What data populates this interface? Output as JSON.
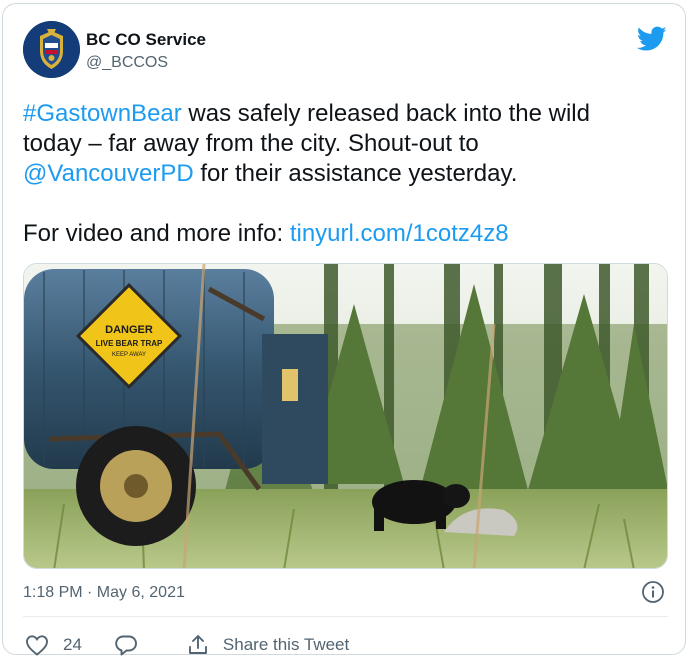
{
  "account": {
    "name": "BC CO Service",
    "handle": "@_BCCOS"
  },
  "tweet": {
    "hashtag": "#GastownBear",
    "line1_rest": " was safely released back into the wild",
    "line2": "today – far away from the city. Shout-out to",
    "mention": "@VancouverPD",
    "line3_rest": " for their assistance yesterday.",
    "video_prefix": "For video and more info: ",
    "video_link": "tinyurl.com/1cotz4z8"
  },
  "media": {
    "sign_line1": "DANGER",
    "sign_line2": "LIVE BEAR TRAP",
    "sign_line3": "KEEP AWAY"
  },
  "meta": {
    "timestamp": "1:18 PM · May 6, 2021"
  },
  "actions": {
    "like_count": "24",
    "share_label": "Share this Tweet"
  },
  "icons": {
    "twitter_logo": "twitter-bird-icon",
    "info": "info-icon",
    "like": "heart-icon",
    "reply": "reply-icon",
    "share": "share-icon"
  },
  "colors": {
    "link": "#1d9bf0",
    "text": "#0f1419",
    "secondary": "#536471",
    "border": "#cfd9de"
  }
}
